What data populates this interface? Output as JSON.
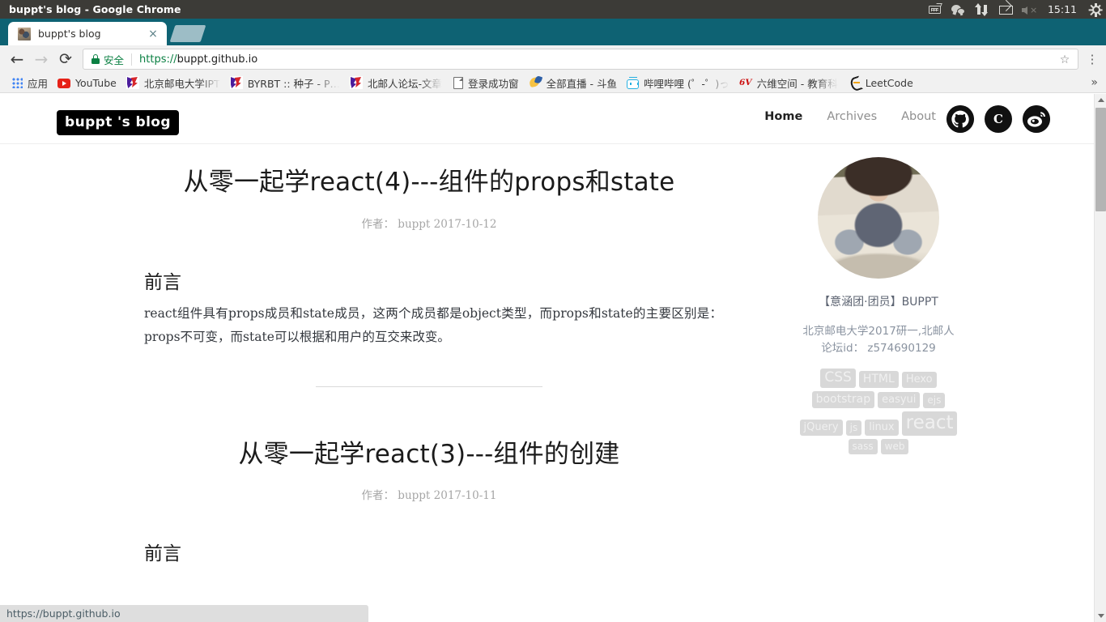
{
  "os": {
    "window_title": "buppt's blog - Google Chrome",
    "clock": "15:11",
    "tray_icons": [
      "keyboard-icon",
      "wechat-icon",
      "network-updown-icon",
      "mail-icon",
      "volume-muted-icon",
      "power-gear-icon"
    ]
  },
  "browser": {
    "tab": {
      "title": "buppt's blog",
      "favicon": "photo-favicon",
      "close_label": "×"
    },
    "new_tab_label": "",
    "toolbar": {
      "back_glyph": "←",
      "forward_glyph": "→",
      "reload_glyph": "⟳",
      "secure_label": "安全",
      "url_scheme": "https://",
      "url_rest": "buppt.github.io",
      "url_full": "https://buppt.github.io",
      "star_glyph": "☆",
      "menu_glyph": "⋮"
    },
    "bookmarks": [
      {
        "label": "应用",
        "icon": "apps-grid-icon",
        "truncated": false
      },
      {
        "label": "YouTube",
        "icon": "youtube-icon",
        "truncated": false
      },
      {
        "label": "北京邮电大学IPT",
        "icon": "utorrent-bird-icon",
        "truncated": true
      },
      {
        "label": "BYRBT :: 种子 - P…",
        "icon": "utorrent-bird-icon",
        "truncated": true
      },
      {
        "label": "北邮人论坛-文章",
        "icon": "utorrent-bird-icon",
        "truncated": true
      },
      {
        "label": "登录成功窗",
        "icon": "document-icon",
        "truncated": false
      },
      {
        "label": "全部直播 - 斗鱼",
        "icon": "douyu-fish-icon",
        "truncated": false
      },
      {
        "label": "哔哩哔哩 (゜-゜)っ",
        "icon": "bilibili-icon",
        "truncated": true
      },
      {
        "label": "六维空间 - 教育科",
        "icon": "sixv-icon",
        "truncated": true
      },
      {
        "label": "LeetCode",
        "icon": "leetcode-icon",
        "truncated": false
      }
    ],
    "bookmarks_overflow_glyph": "»",
    "status_bar_url": "https://buppt.github.io",
    "scrollbar": {
      "up_glyph": "▲",
      "down_glyph": "▼"
    }
  },
  "site": {
    "brand": "buppt 's blog",
    "nav": [
      {
        "label": "Home",
        "active": true
      },
      {
        "label": "Archives",
        "active": false
      },
      {
        "label": "About",
        "active": false
      }
    ],
    "social": [
      {
        "name": "github-icon",
        "label": ""
      },
      {
        "name": "csdn-icon",
        "label": "C"
      },
      {
        "name": "weibo-icon",
        "label": ""
      }
    ]
  },
  "posts": [
    {
      "title": "从零一起学react(4)---组件的props和state",
      "meta": "作者： buppt 2017-10-12",
      "heading": "前言",
      "body": "react组件具有props成员和state成员，这两个成员都是object类型，而props和state的主要区别是：props不可变，而state可以根据和用户的互交来改变。"
    },
    {
      "title": "从零一起学react(3)---组件的创建",
      "meta": "作者： buppt 2017-10-11",
      "heading": "前言",
      "body": ""
    }
  ],
  "sidebar": {
    "avatar": "profile-photo",
    "name": "【意涵团·团员】BUPPT",
    "desc_line1": "北京邮电大学2017研一,北邮人",
    "desc_line2": "论坛id： z574690129",
    "tags": [
      {
        "label": "CSS",
        "size": 17
      },
      {
        "label": "HTML",
        "size": 14
      },
      {
        "label": "Hexo",
        "size": 13
      },
      {
        "label": "bootstrap",
        "size": 14
      },
      {
        "label": "easyui",
        "size": 13
      },
      {
        "label": "ejs",
        "size": 12
      },
      {
        "label": "jQuery",
        "size": 13
      },
      {
        "label": "js",
        "size": 12
      },
      {
        "label": "linux",
        "size": 13
      },
      {
        "label": "react",
        "size": 23
      },
      {
        "label": "sass",
        "size": 12
      },
      {
        "label": "web",
        "size": 12
      }
    ]
  },
  "colors": {
    "os_titlebar": "#3c3b37",
    "tabstrip": "#0e6273",
    "toolbar": "#f1f1f1",
    "secure_green": "#0b8043",
    "brand_bg": "#000000",
    "tag_bg": "#d8d8d8",
    "status_bubble": "#dedede"
  }
}
